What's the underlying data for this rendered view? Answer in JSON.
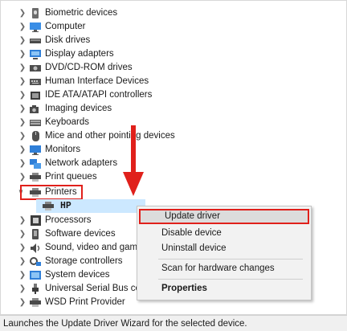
{
  "tree": {
    "items": [
      {
        "label": "Biometric devices",
        "icon": "biometric-icon"
      },
      {
        "label": "Computer",
        "icon": "computer-icon"
      },
      {
        "label": "Disk drives",
        "icon": "disk-drive-icon"
      },
      {
        "label": "Display adapters",
        "icon": "display-adapter-icon"
      },
      {
        "label": "DVD/CD-ROM drives",
        "icon": "dvd-drive-icon"
      },
      {
        "label": "Human Interface Devices",
        "icon": "hid-icon"
      },
      {
        "label": "IDE ATA/ATAPI controllers",
        "icon": "ide-controller-icon"
      },
      {
        "label": "Imaging devices",
        "icon": "imaging-device-icon"
      },
      {
        "label": "Keyboards",
        "icon": "keyboard-icon"
      },
      {
        "label": "Mice and other pointing devices",
        "icon": "mouse-icon"
      },
      {
        "label": "Monitors",
        "icon": "monitor-icon"
      },
      {
        "label": "Network adapters",
        "icon": "network-adapter-icon"
      },
      {
        "label": "Print queues",
        "icon": "print-queue-icon"
      },
      {
        "label": "Printers",
        "icon": "printer-icon"
      },
      {
        "label": "HP",
        "icon": "printer-icon"
      },
      {
        "label": "Processors",
        "icon": "processor-icon"
      },
      {
        "label": "Software devices",
        "icon": "software-device-icon"
      },
      {
        "label": "Sound, video and game controllers",
        "icon": "sound-icon"
      },
      {
        "label": "Storage controllers",
        "icon": "storage-controller-icon"
      },
      {
        "label": "System devices",
        "icon": "system-device-icon"
      },
      {
        "label": "Universal Serial Bus controllers",
        "icon": "usb-icon"
      },
      {
        "label": "WSD Print Provider",
        "icon": "wsd-printer-icon"
      }
    ]
  },
  "context_menu": {
    "update_driver": "Update driver",
    "disable_device": "Disable device",
    "uninstall_device": "Uninstall device",
    "scan_hardware": "Scan for hardware changes",
    "properties": "Properties"
  },
  "status_bar": {
    "text": "Launches the Update Driver Wizard for the selected device."
  },
  "colors": {
    "highlight_red": "#e0201b",
    "selection_blue": "#cce8ff"
  }
}
